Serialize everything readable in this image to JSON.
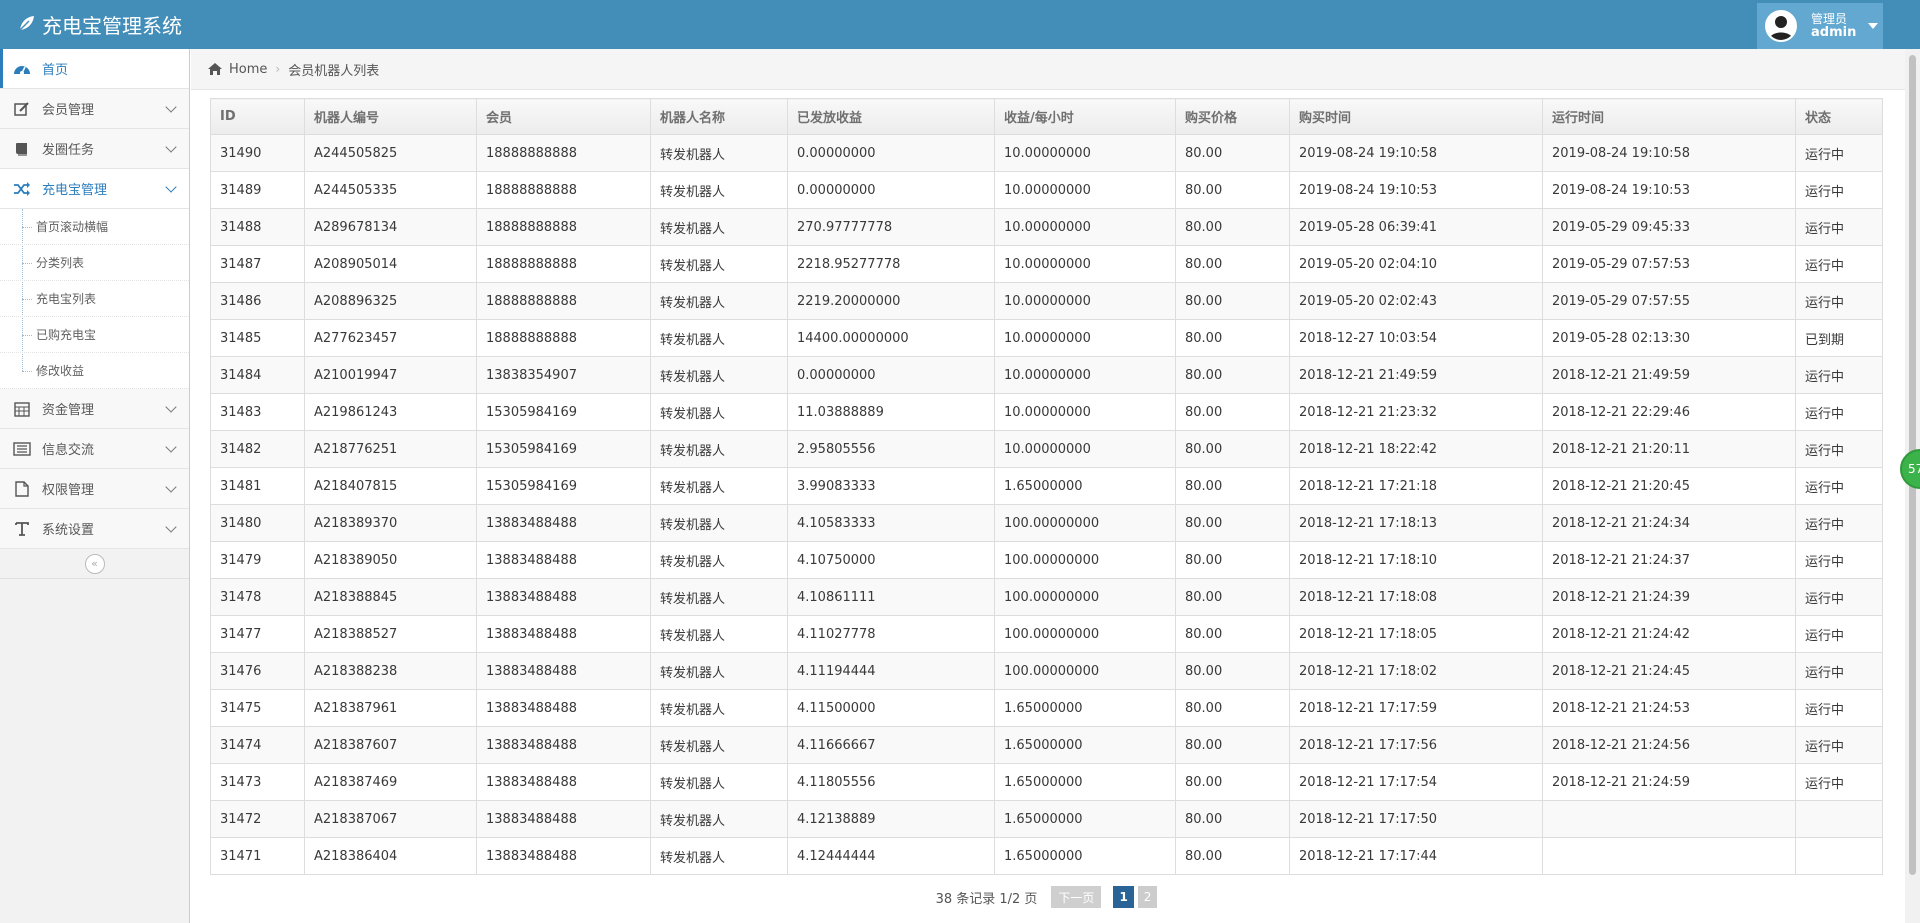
{
  "app": {
    "title": "充电宝管理系统"
  },
  "user": {
    "role": "管理员",
    "name": "admin"
  },
  "sidebar": {
    "items": [
      {
        "label": "首页"
      },
      {
        "label": "会员管理"
      },
      {
        "label": "发圈任务"
      },
      {
        "label": "充电宝管理"
      },
      {
        "label": "资金管理"
      },
      {
        "label": "信息交流"
      },
      {
        "label": "权限管理"
      },
      {
        "label": "系统设置"
      }
    ],
    "sub_items": [
      {
        "label": "首页滚动横幅"
      },
      {
        "label": "分类列表"
      },
      {
        "label": "充电宝列表"
      },
      {
        "label": "已购充电宝"
      },
      {
        "label": "修改收益"
      }
    ],
    "collapse_glyph": "«"
  },
  "breadcrumb": {
    "home": "Home",
    "current": "会员机器人列表"
  },
  "table": {
    "headers": [
      "ID",
      "机器人编号",
      "会员",
      "机器人名称",
      "已发放收益",
      "收益/每小时",
      "购买价格",
      "购买时间",
      "运行时间",
      "状态"
    ],
    "rows": [
      [
        "31490",
        "A244505825",
        "18888888888",
        "转发机器人",
        "0.00000000",
        "10.00000000",
        "80.00",
        "2019-08-24 19:10:58",
        "2019-08-24 19:10:58",
        "运行中"
      ],
      [
        "31489",
        "A244505335",
        "18888888888",
        "转发机器人",
        "0.00000000",
        "10.00000000",
        "80.00",
        "2019-08-24 19:10:53",
        "2019-08-24 19:10:53",
        "运行中"
      ],
      [
        "31488",
        "A289678134",
        "18888888888",
        "转发机器人",
        "270.97777778",
        "10.00000000",
        "80.00",
        "2019-05-28 06:39:41",
        "2019-05-29 09:45:33",
        "运行中"
      ],
      [
        "31487",
        "A208905014",
        "18888888888",
        "转发机器人",
        "2218.95277778",
        "10.00000000",
        "80.00",
        "2019-05-20 02:04:10",
        "2019-05-29 07:57:53",
        "运行中"
      ],
      [
        "31486",
        "A208896325",
        "18888888888",
        "转发机器人",
        "2219.20000000",
        "10.00000000",
        "80.00",
        "2019-05-20 02:02:43",
        "2019-05-29 07:57:55",
        "运行中"
      ],
      [
        "31485",
        "A277623457",
        "18888888888",
        "转发机器人",
        "14400.00000000",
        "10.00000000",
        "80.00",
        "2018-12-27 10:03:54",
        "2019-05-28 02:13:30",
        "已到期"
      ],
      [
        "31484",
        "A210019947",
        "13838354907",
        "转发机器人",
        "0.00000000",
        "10.00000000",
        "80.00",
        "2018-12-21 21:49:59",
        "2018-12-21 21:49:59",
        "运行中"
      ],
      [
        "31483",
        "A219861243",
        "15305984169",
        "转发机器人",
        "11.03888889",
        "10.00000000",
        "80.00",
        "2018-12-21 21:23:32",
        "2018-12-21 22:29:46",
        "运行中"
      ],
      [
        "31482",
        "A218776251",
        "15305984169",
        "转发机器人",
        "2.95805556",
        "10.00000000",
        "80.00",
        "2018-12-21 18:22:42",
        "2018-12-21 21:20:11",
        "运行中"
      ],
      [
        "31481",
        "A218407815",
        "15305984169",
        "转发机器人",
        "3.99083333",
        "1.65000000",
        "80.00",
        "2018-12-21 17:21:18",
        "2018-12-21 21:20:45",
        "运行中"
      ],
      [
        "31480",
        "A218389370",
        "13883488488",
        "转发机器人",
        "4.10583333",
        "100.00000000",
        "80.00",
        "2018-12-21 17:18:13",
        "2018-12-21 21:24:34",
        "运行中"
      ],
      [
        "31479",
        "A218389050",
        "13883488488",
        "转发机器人",
        "4.10750000",
        "100.00000000",
        "80.00",
        "2018-12-21 17:18:10",
        "2018-12-21 21:24:37",
        "运行中"
      ],
      [
        "31478",
        "A218388845",
        "13883488488",
        "转发机器人",
        "4.10861111",
        "100.00000000",
        "80.00",
        "2018-12-21 17:18:08",
        "2018-12-21 21:24:39",
        "运行中"
      ],
      [
        "31477",
        "A218388527",
        "13883488488",
        "转发机器人",
        "4.11027778",
        "100.00000000",
        "80.00",
        "2018-12-21 17:18:05",
        "2018-12-21 21:24:42",
        "运行中"
      ],
      [
        "31476",
        "A218388238",
        "13883488488",
        "转发机器人",
        "4.11194444",
        "100.00000000",
        "80.00",
        "2018-12-21 17:18:02",
        "2018-12-21 21:24:45",
        "运行中"
      ],
      [
        "31475",
        "A218387961",
        "13883488488",
        "转发机器人",
        "4.11500000",
        "1.65000000",
        "80.00",
        "2018-12-21 17:17:59",
        "2018-12-21 21:24:53",
        "运行中"
      ],
      [
        "31474",
        "A218387607",
        "13883488488",
        "转发机器人",
        "4.11666667",
        "1.65000000",
        "80.00",
        "2018-12-21 17:17:56",
        "2018-12-21 21:24:56",
        "运行中"
      ],
      [
        "31473",
        "A218387469",
        "13883488488",
        "转发机器人",
        "4.11805556",
        "1.65000000",
        "80.00",
        "2018-12-21 17:17:54",
        "2018-12-21 21:24:59",
        "运行中"
      ],
      [
        "31472",
        "A218387067",
        "13883488488",
        "转发机器人",
        "4.12138889",
        "1.65000000",
        "80.00",
        "2018-12-21 17:17:50",
        "",
        ""
      ],
      [
        "31471",
        "A218386404",
        "13883488488",
        "转发机器人",
        "4.12444444",
        "1.65000000",
        "80.00",
        "2018-12-21 17:17:44",
        "",
        ""
      ]
    ]
  },
  "pagination": {
    "info": "38 条记录 1/2 页",
    "next_label": "下一页",
    "pages": [
      "1",
      "2"
    ]
  },
  "float_badge": {
    "label": "57"
  },
  "colors": {
    "navbar": "#438eb9",
    "user_box": "#62a8d1",
    "accent": "#2b7dbc",
    "float_badge": "#3cb34a"
  }
}
